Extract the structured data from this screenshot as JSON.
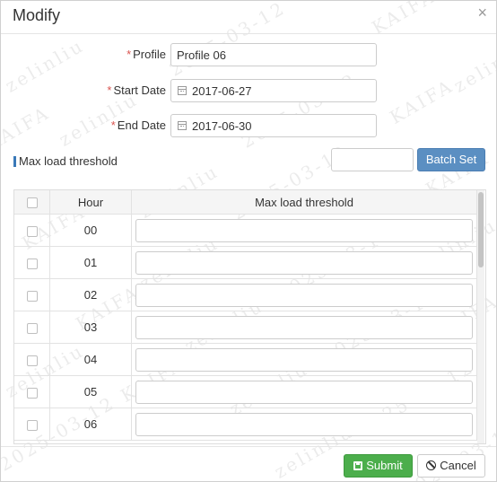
{
  "dialog": {
    "title": "Modify",
    "close_glyph": "×"
  },
  "form": {
    "required_mark": "*",
    "profile": {
      "label": "Profile",
      "value": "Profile 06"
    },
    "start_date": {
      "label": "Start Date",
      "value": "2017-06-27",
      "icon": "calendar-icon"
    },
    "end_date": {
      "label": "End Date",
      "value": "2017-06-30",
      "icon": "calendar-icon"
    }
  },
  "section": {
    "label": "Max load threshold",
    "batch_input_value": "",
    "batch_button_label": "Batch Set"
  },
  "table": {
    "headers": {
      "hour": "Hour",
      "threshold": "Max load threshold"
    },
    "rows": [
      {
        "hour": "00",
        "value": ""
      },
      {
        "hour": "01",
        "value": ""
      },
      {
        "hour": "02",
        "value": ""
      },
      {
        "hour": "03",
        "value": ""
      },
      {
        "hour": "04",
        "value": ""
      },
      {
        "hour": "05",
        "value": ""
      },
      {
        "hour": "06",
        "value": ""
      }
    ]
  },
  "footer": {
    "submit_label": "Submit",
    "cancel_label": "Cancel",
    "submit_icon": "save-icon",
    "cancel_icon": "ban-icon"
  },
  "watermark": {
    "texts": [
      "zelinliu",
      "2025-03-12",
      "KAIFA"
    ]
  },
  "colors": {
    "accent_blue": "#5b8fc2",
    "submit_green": "#4cae4c",
    "required_red": "#d9534f",
    "section_bar": "#3a79b8"
  }
}
